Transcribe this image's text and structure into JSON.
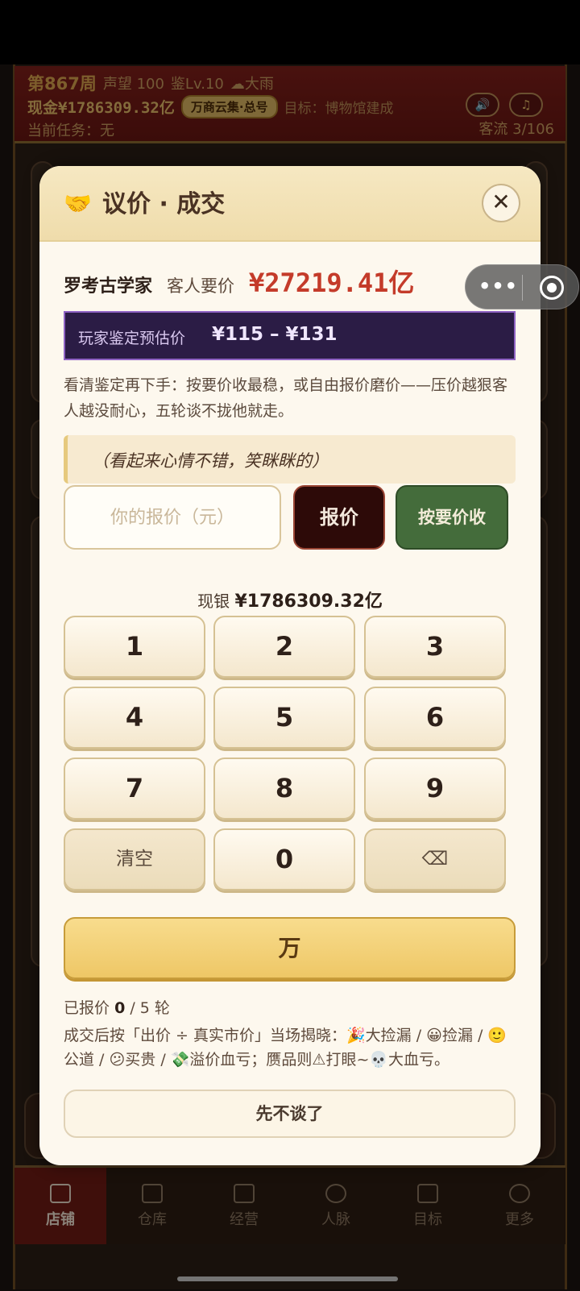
{
  "hud": {
    "week": "第867周",
    "reputation": "声望 100",
    "appraisal_level": "鉴Lv.10",
    "weather": "☁大雨",
    "cash": "现金¥1786309.32亿",
    "badge": "万商云集·总号",
    "target": "目标：博物馆建成",
    "task": "当前任务：无",
    "sound_icon": "speaker-icon",
    "music_icon": "music-icon",
    "sound_glyph": "🔊",
    "music_glyph": "♫",
    "traffic": "客流 3/106"
  },
  "capsule": {
    "menu_glyph": "•••"
  },
  "dialog": {
    "title_icon": "handshake-icon",
    "title_glyph": "🤝",
    "title": "议价 · 成交",
    "close_glyph": "✕",
    "guest_name": "罗考古学家",
    "ask_label": "客人要价",
    "ask_price": "¥27219.41亿",
    "estimate_label": "玩家鉴定预估价",
    "estimate_range": "¥115 – ¥131",
    "hint": "看清鉴定再下手：按要价收最稳，或自由报价磨价——压价越狠客人越没耐心，五轮谈不拢他就走。",
    "mood": "（看起来心情不错，笑眯眯的）",
    "offer_placeholder": "你的报价（元）",
    "offer_value": "",
    "offer_button": "报价",
    "accept_button": "按要价收",
    "cash_label": "现银",
    "cash_value": "¥1786309.32亿",
    "keypad": {
      "k1": "1",
      "k2": "2",
      "k3": "3",
      "k4": "4",
      "k5": "5",
      "k6": "6",
      "k7": "7",
      "k8": "8",
      "k9": "9",
      "clear": "清空",
      "k0": "0",
      "backspace": "⌫",
      "wan": "万"
    },
    "round_prefix": "已报价",
    "rounds_done": "0",
    "rounds_total": "/ 5 轮",
    "reveal": "成交后按「出价 ÷ 真实市价」当场揭晓：🎉大捡漏 / 😀捡漏 / 🙂公道 / 😕买贵 / 💸溢价血亏；赝品则⚠打眼~💀大血亏。",
    "quit_button": "先不谈了"
  },
  "nav": {
    "items": [
      {
        "label": "店铺",
        "icon": "shop-icon",
        "active": true
      },
      {
        "label": "仓库",
        "icon": "warehouse-icon",
        "active": false
      },
      {
        "label": "经营",
        "icon": "business-icon",
        "active": false
      },
      {
        "label": "人脉",
        "icon": "contacts-icon",
        "active": false
      },
      {
        "label": "目标",
        "icon": "target-icon",
        "active": false
      },
      {
        "label": "更多",
        "icon": "more-icon",
        "active": false
      }
    ]
  },
  "colors": {
    "accent_red": "#c43b2a",
    "estimate_bg": "#2b1c45",
    "accept_green": "#446c3b",
    "offer_dark": "#2d0a08",
    "wan_gold": "#eec766"
  }
}
